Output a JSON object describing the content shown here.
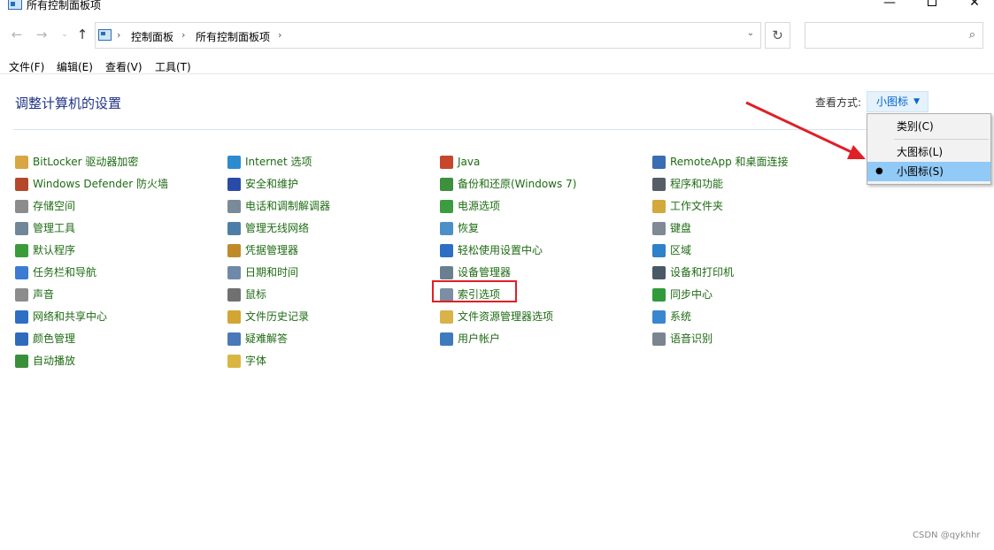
{
  "window": {
    "title": "所有控制面板项",
    "minimize": "—",
    "close": "✕"
  },
  "nav": {
    "back_icon": "←",
    "forward_icon": "→",
    "recent_icon": "⌄",
    "up_icon": "↑",
    "breadcrumb": [
      "控制面板",
      "所有控制面板项"
    ],
    "separator": "›",
    "dropdown_icon": "⌄",
    "refresh_icon": "↻",
    "search_value": "",
    "search_placeholder": "",
    "search_icon": "⌕"
  },
  "menubar": [
    "文件(F)",
    "编辑(E)",
    "查看(V)",
    "工具(T)"
  ],
  "header": {
    "title": "调整计算机的设置",
    "view_label": "查看方式:",
    "view_selected": "小图标",
    "caret": "▼"
  },
  "dropdown": {
    "items": [
      {
        "label": "类别(C)",
        "checked": false
      },
      {
        "label": "大图标(L)",
        "checked": false
      },
      {
        "label": "小图标(S)",
        "checked": true
      }
    ],
    "bullet": "●"
  },
  "columns": [
    [
      {
        "label": "BitLocker 驱动器加密",
        "icon": "bitlocker-icon",
        "color": "#d8a642"
      },
      {
        "label": "Windows Defender 防火墙",
        "icon": "firewall-icon",
        "color": "#b5482b"
      },
      {
        "label": "存储空间",
        "icon": "storage-icon",
        "color": "#8c8c8c"
      },
      {
        "label": "管理工具",
        "icon": "admin-tools-icon",
        "color": "#6f8796"
      },
      {
        "label": "默认程序",
        "icon": "default-programs-icon",
        "color": "#3b9b3b"
      },
      {
        "label": "任务栏和导航",
        "icon": "taskbar-icon",
        "color": "#3b7bd4"
      },
      {
        "label": "声音",
        "icon": "speaker-icon",
        "color": "#8d8d8d"
      },
      {
        "label": "网络和共享中心",
        "icon": "network-icon",
        "color": "#2c6fc4"
      },
      {
        "label": "颜色管理",
        "icon": "color-management-icon",
        "color": "#2f6bbd"
      },
      {
        "label": "自动播放",
        "icon": "autoplay-icon",
        "color": "#3a8f3a"
      }
    ],
    [
      {
        "label": "Internet 选项",
        "icon": "internet-options-icon",
        "color": "#2d8bd0"
      },
      {
        "label": "安全和维护",
        "icon": "flag-icon",
        "color": "#2a4ca8"
      },
      {
        "label": "电话和调制解调器",
        "icon": "phone-modem-icon",
        "color": "#7b8a99"
      },
      {
        "label": "管理无线网络",
        "icon": "wireless-icon",
        "color": "#4d7ea8"
      },
      {
        "label": "凭据管理器",
        "icon": "credential-icon",
        "color": "#c08a2a"
      },
      {
        "label": "日期和时间",
        "icon": "clock-icon",
        "color": "#6f8aa8"
      },
      {
        "label": "鼠标",
        "icon": "mouse-icon",
        "color": "#707070"
      },
      {
        "label": "文件历史记录",
        "icon": "file-history-icon",
        "color": "#d2a634"
      },
      {
        "label": "疑难解答",
        "icon": "troubleshoot-icon",
        "color": "#4a78b8"
      },
      {
        "label": "字体",
        "icon": "font-icon",
        "color": "#d9b642"
      }
    ],
    [
      {
        "label": "Java",
        "icon": "java-icon",
        "color": "#c7462c"
      },
      {
        "label": "备份和还原(Windows 7)",
        "icon": "backup-icon",
        "color": "#3e8f3e"
      },
      {
        "label": "电源选项",
        "icon": "power-icon",
        "color": "#3d9b41"
      },
      {
        "label": "恢复",
        "icon": "recovery-icon",
        "color": "#4d8fc9"
      },
      {
        "label": "轻松使用设置中心",
        "icon": "ease-of-access-icon",
        "color": "#2c6fc4"
      },
      {
        "label": "设备管理器",
        "icon": "device-manager-icon",
        "color": "#6a7f8f"
      },
      {
        "label": "索引选项",
        "icon": "indexing-icon",
        "color": "#7c8ea3"
      },
      {
        "label": "文件资源管理器选项",
        "icon": "folder-options-icon",
        "color": "#d9b24a"
      },
      {
        "label": "用户帐户",
        "icon": "user-accounts-icon",
        "color": "#3d7bbd"
      }
    ],
    [
      {
        "label": "RemoteApp 和桌面连接",
        "icon": "remoteapp-icon",
        "color": "#3a6db1"
      },
      {
        "label": "程序和功能",
        "icon": "programs-icon",
        "color": "#555d66"
      },
      {
        "label": "工作文件夹",
        "icon": "work-folders-icon",
        "color": "#d4a93c"
      },
      {
        "label": "键盘",
        "icon": "keyboard-icon",
        "color": "#7f8a95"
      },
      {
        "label": "区域",
        "icon": "region-icon",
        "color": "#2d82c9"
      },
      {
        "label": "设备和打印机",
        "icon": "printer-icon",
        "color": "#4a5966"
      },
      {
        "label": "同步中心",
        "icon": "sync-icon",
        "color": "#2f9b3a"
      },
      {
        "label": "系统",
        "icon": "system-icon",
        "color": "#3b86d0"
      },
      {
        "label": "语音识别",
        "icon": "microphone-icon",
        "color": "#7a8590"
      }
    ]
  ],
  "highlight": {
    "label": "索引选项",
    "color": "#e01f26"
  },
  "annotation_arrow_color": "#e01f26",
  "watermark": "CSDN @qykhhr"
}
